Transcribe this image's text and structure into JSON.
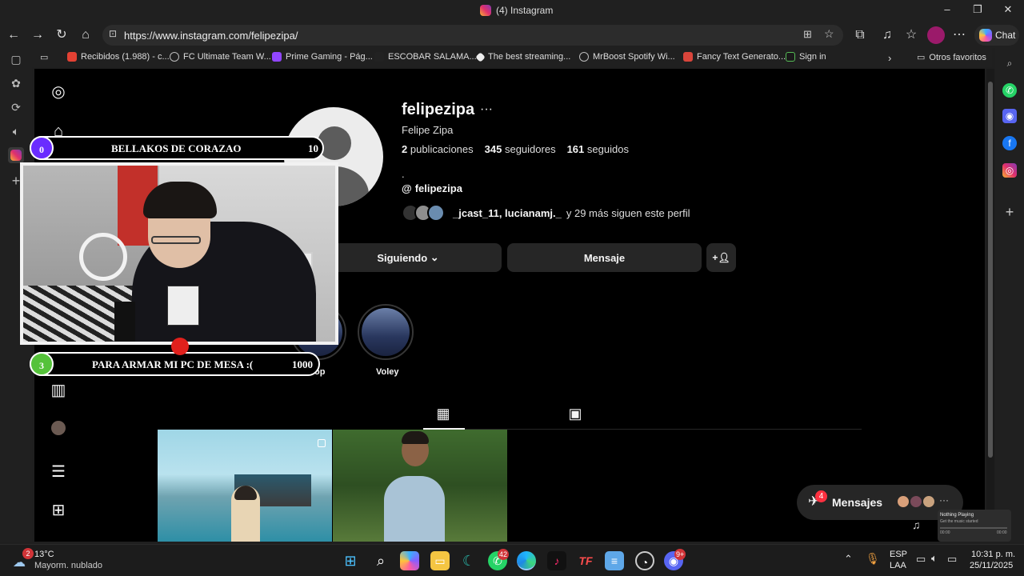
{
  "window": {
    "title": "(4) Instagram"
  },
  "browser": {
    "url": "https://www.instagram.com/felipezipa/",
    "chat_label": "Chat",
    "bookmarks": [
      "Recibidos (1.988) - c...",
      "FC Ultimate Team W...",
      "Prime Gaming - Pág...",
      "ESCOBAR SALAMA...",
      "The best streaming...",
      "MrBoost Spotify Wi...",
      "Fancy Text Generato...",
      "Sign in"
    ],
    "other_favorites": "Otros favoritos"
  },
  "profile": {
    "username": "felipezipa",
    "more": "···",
    "full_name": "Felipe Zipa",
    "posts_count": "2",
    "posts_label": "publicaciones",
    "followers_count": "345",
    "followers_label": "seguidores",
    "following_count": "161",
    "following_label": "seguidos",
    "bio": ".",
    "threads_handle": "felipezipa",
    "followed_by": "_jcast_11, lucianamj._",
    "followed_by_rest": "y 29 más siguen este perfil",
    "following_button": "Siguiendo",
    "message_button": "Mensaje",
    "highlights": [
      {
        "label": "op"
      },
      {
        "label": "Voley"
      }
    ]
  },
  "messages": {
    "label": "Mensajes",
    "badge": "4"
  },
  "overlay": {
    "goal1": {
      "count": "0",
      "text": "BELLAKOS DE CORAZAO",
      "target": "10"
    },
    "goal2": {
      "count": "3",
      "text": "PARA ARMAR MI PC DE MESA :(",
      "target": "1000"
    }
  },
  "media": {
    "title": "Nothing Playing",
    "subtitle": "Get the music started",
    "time_start": "00:00",
    "time_end": "00:00"
  },
  "taskbar": {
    "weather_temp": "13°C",
    "weather_desc": "Mayorm. nublado",
    "weather_badge": "2",
    "whatsapp_badge": "42",
    "discord_badge": "9+",
    "lang": "ESP",
    "lang2": "LAA",
    "time": "10:31 p. m.",
    "date": "25/11/2025"
  },
  "colors": {
    "page_bg": "#000000",
    "browser_chrome": "#202020",
    "button_bg": "#262626",
    "notif_red": "#ff3040",
    "goal_purple": "#6a2cff",
    "goal_green": "#55c23a"
  }
}
